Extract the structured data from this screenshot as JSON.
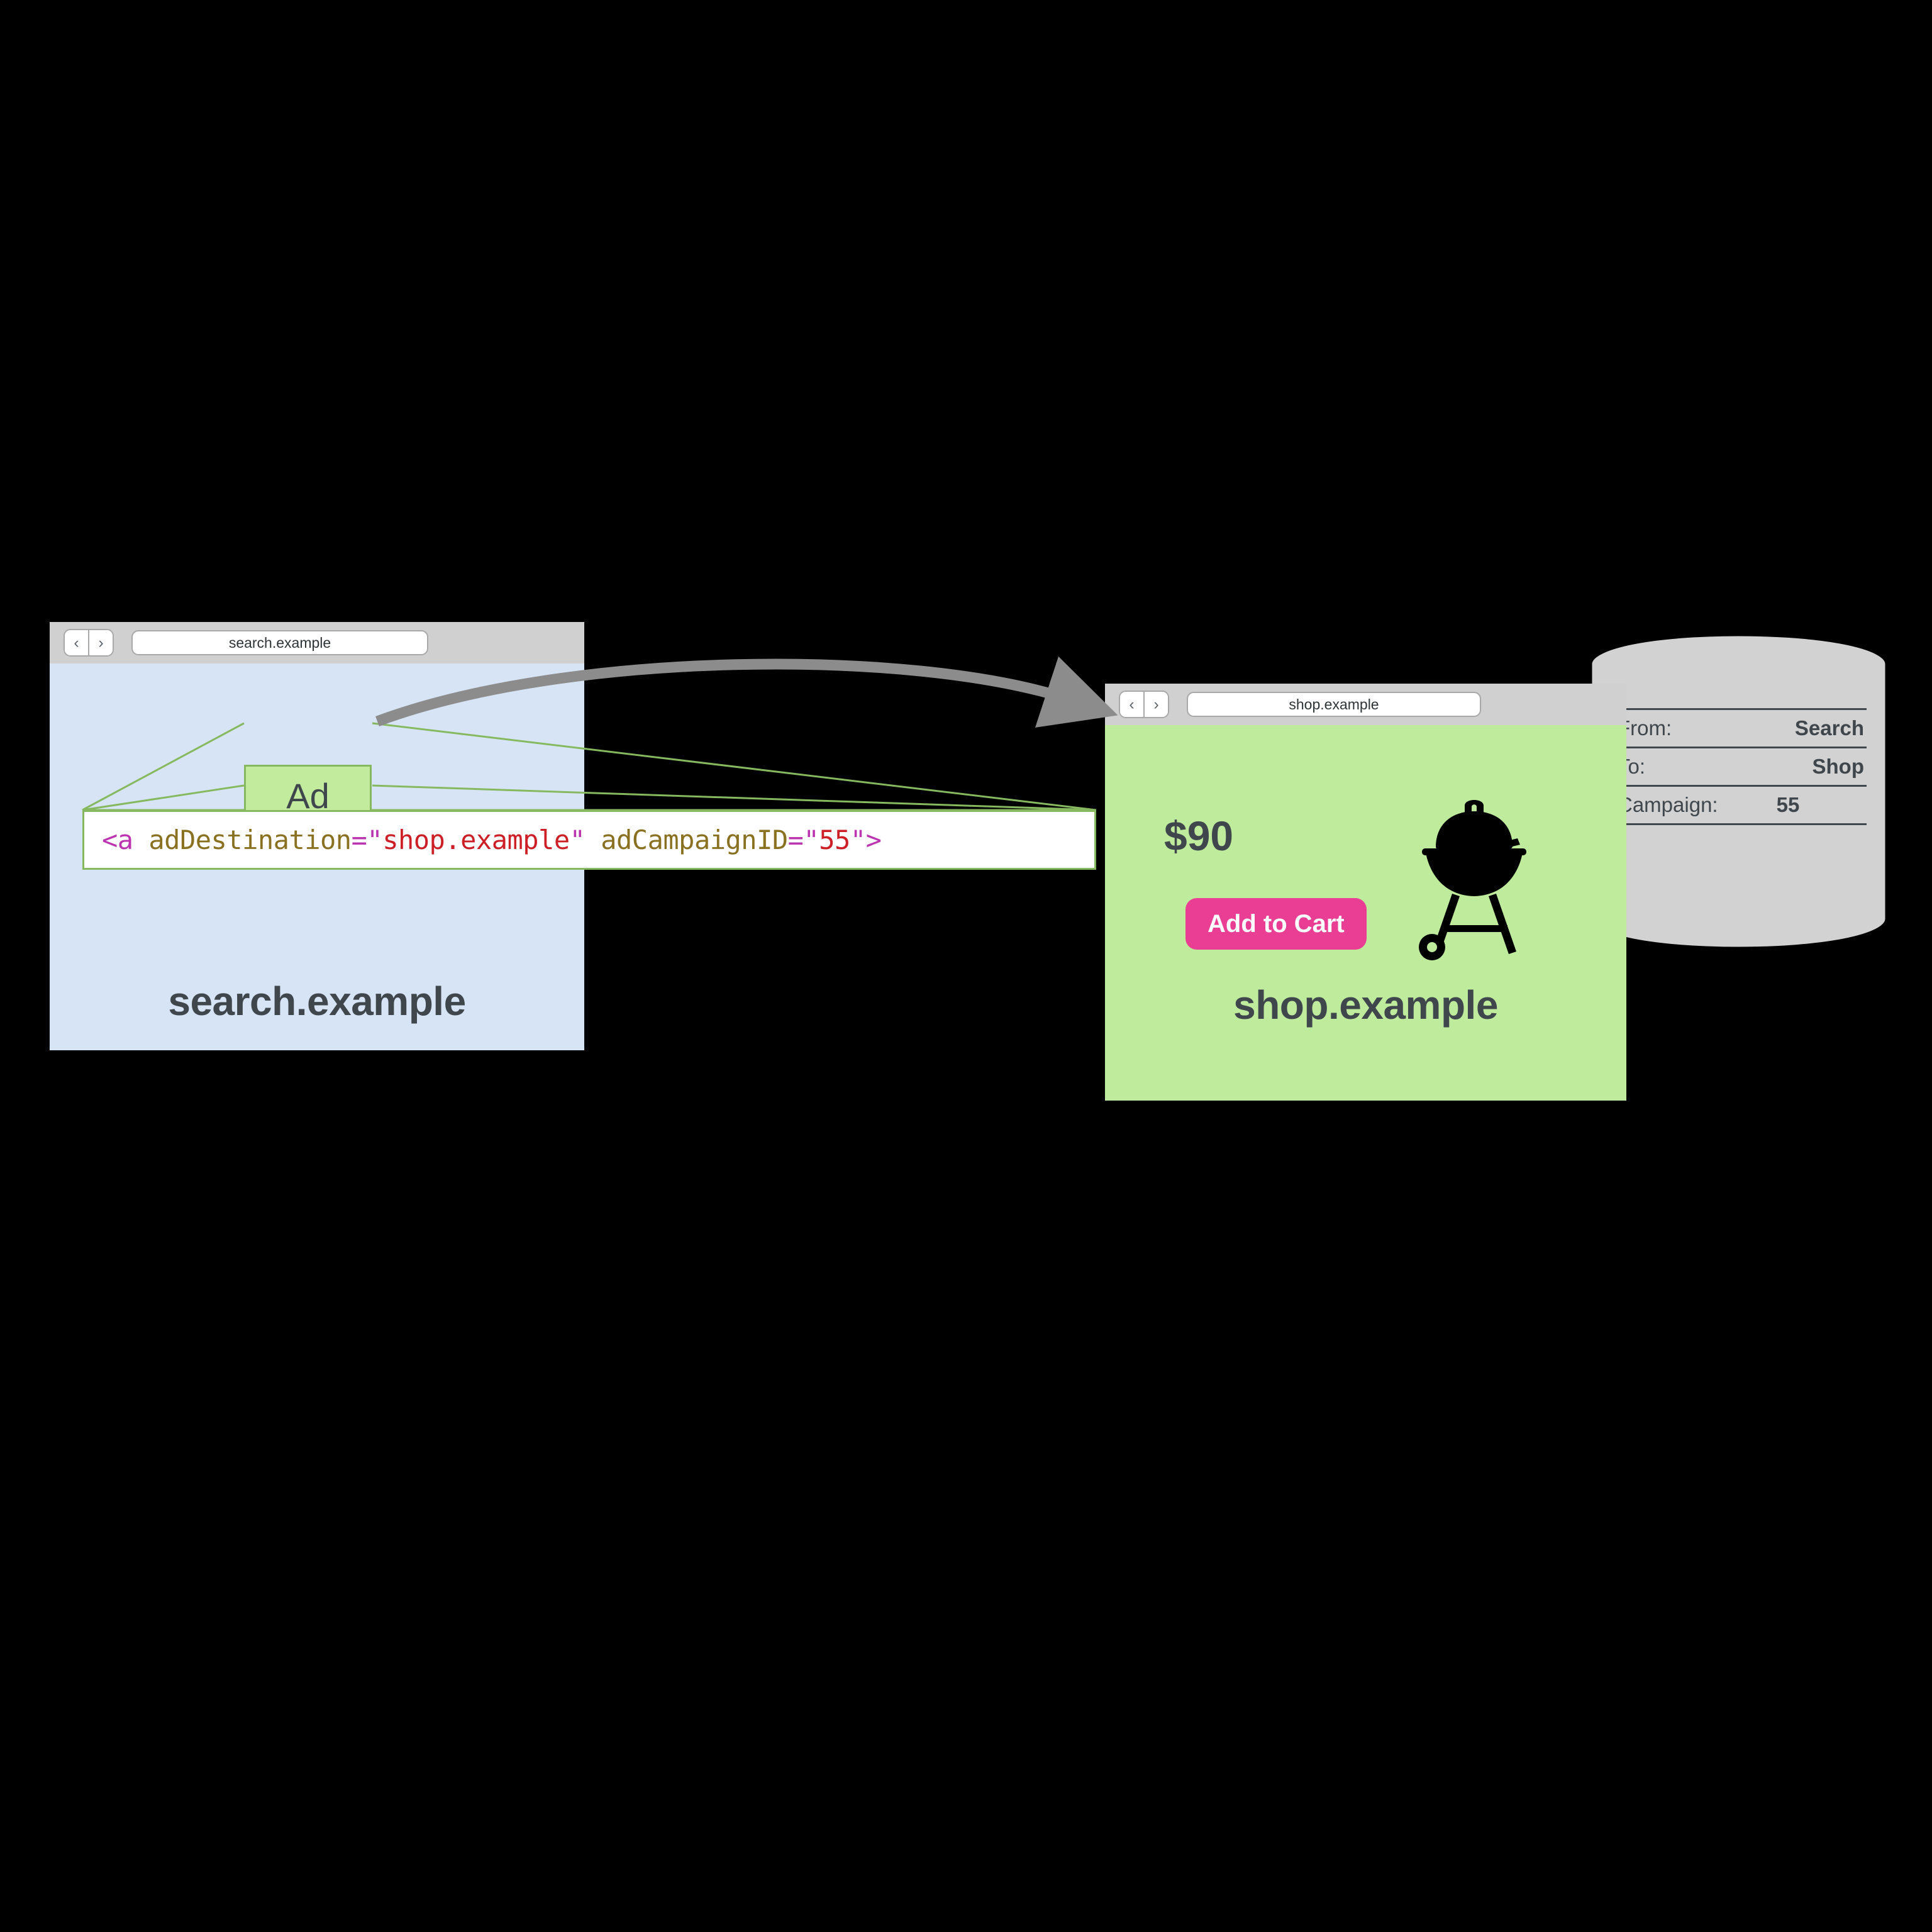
{
  "search_window": {
    "nav": {
      "back": "‹",
      "forward": "›"
    },
    "url": "search.example",
    "page_title": "search.example",
    "ad_label": "Ad"
  },
  "code_callout": {
    "full_text": "<a adDestination=\"shop.example\" adCampaignID=\"55\">",
    "tokens": {
      "tag_open": "<a",
      "attr1_name": "adDestination",
      "eq1": "=",
      "quote_open1": "\"",
      "attr1_value": "shop.example",
      "quote_close1": "\"",
      "attr2_name": "adCampaignID",
      "eq2": "=",
      "quote_open2": "\"",
      "attr2_value": "55",
      "quote_close2": "\"",
      "tag_close": ">"
    },
    "colors": {
      "tag": "#bb34b0",
      "attr": "#8a7122",
      "value": "#cc1f26",
      "border": "#86b95f",
      "background": "#ffffff"
    }
  },
  "shop_window": {
    "nav": {
      "back": "‹",
      "forward": "›"
    },
    "url": "shop.example",
    "price": "$90",
    "add_to_cart_label": "Add to Cart",
    "product_icon": "grill-icon",
    "page_title": "shop.example"
  },
  "database": {
    "rows": [
      {
        "key": "From:",
        "value": "Search",
        "align": "right"
      },
      {
        "key": "To:",
        "value": "Shop",
        "align": "right"
      },
      {
        "key": "Campaign:",
        "value": "55",
        "align": "left"
      }
    ]
  },
  "connector": {
    "arrow_label": "navigation-arrow",
    "arrow_color": "#8c8c8c",
    "callout_line_color": "#86b95f"
  },
  "palette": {
    "background": "#000000",
    "chrome_gray": "#d0d0d0",
    "search_page_bg": "#d7e4f5",
    "shop_page_bg": "#bfeb9c",
    "ad_box_bg": "#c2eb9e",
    "ad_box_border": "#86b95f",
    "cta_pink": "#ea3e95",
    "text_dark": "#3f474d",
    "db_fill": "#d2d2d2",
    "db_stroke": "#000000"
  }
}
